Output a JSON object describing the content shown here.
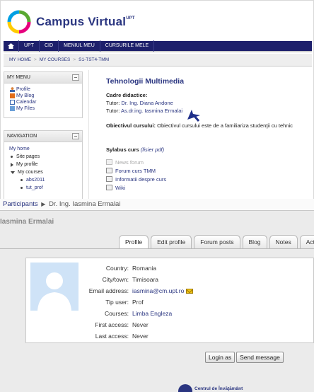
{
  "top": {
    "brand": {
      "name": "Campus Virtual",
      "superscript": "UPT"
    },
    "navbar": [
      "UPT",
      "CID",
      "MENIUL MEU",
      "CURSURILE MELE"
    ],
    "breadcrumb": [
      "MY HOME",
      "MY COURSES",
      "S1-TST4-TMM"
    ],
    "my_menu": {
      "title": "MY MENU",
      "items": [
        "Profile",
        "My Blog",
        "Calendar",
        "My Files"
      ]
    },
    "navigation": {
      "title": "NAVIGATION",
      "items": [
        "My home",
        "Site pages",
        "My profile",
        "My courses",
        "abs2011",
        "tut_prof"
      ]
    },
    "course": {
      "title": "Tehnologii Multimedia",
      "cadre_label": "Cadre didactice:",
      "tutor1_prefix": "Tutor:",
      "tutor1_name": "Dr. Ing. Diana Andone",
      "tutor2_prefix": "Tutor:",
      "tutor2_name": "As.dr.ing. Iasmina Ermalai",
      "objective_label": "Obiectivul cursului:",
      "objective_text": "Obiectivul cursului este de a familiariza studenţii cu tehnic",
      "syllabus_label": "Sylabus curs",
      "syllabus_link": "(fisier pdf)",
      "resources": [
        "News forum",
        "Forum curs TMM",
        "Informatii despre curs",
        "Wiki"
      ]
    }
  },
  "bottom": {
    "breadcrumb": {
      "root": "Participants",
      "current": "Dr. Ing. Iasmina Ermalai"
    },
    "profile_name": "Iasmina Ermalai",
    "tabs": [
      "Profile",
      "Edit profile",
      "Forum posts",
      "Blog",
      "Notes",
      "Activi"
    ],
    "fields": [
      {
        "label": "Country:",
        "value": "Romania"
      },
      {
        "label": "City/town:",
        "value": "Timisoara"
      },
      {
        "label": "Email address:",
        "value": "iasmina@cm.upt.ro"
      },
      {
        "label": "Tip user:",
        "value": "Prof"
      },
      {
        "label": "Courses:",
        "value": "Limba Engleza"
      },
      {
        "label": "First access:",
        "value": "Never"
      },
      {
        "label": "Last access:",
        "value": "Never"
      }
    ],
    "buttons": {
      "login_as": "Login as",
      "send_message": "Send message"
    },
    "footer_logo": "Centrul de Învăţământ"
  },
  "colors": {
    "navbar": "#1d1f6b",
    "link": "#2a3580",
    "arrow": "#1f2f8a"
  },
  "icons": {
    "home": "home-icon",
    "block_toggle": "collapse-icon",
    "mail": "mail-icon",
    "pointer": "arrow-pointer-icon"
  }
}
